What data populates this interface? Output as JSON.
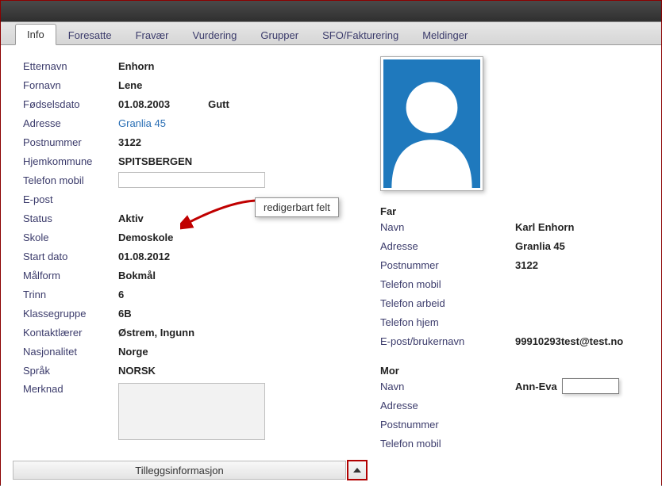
{
  "tabs": [
    "Info",
    "Foresatte",
    "Fravær",
    "Vurdering",
    "Grupper",
    "SFO/Fakturering",
    "Meldinger"
  ],
  "active_tab": 0,
  "callout": "redigerbart felt",
  "student": {
    "labels": {
      "etternavn": "Etternavn",
      "fornavn": "Fornavn",
      "fodselsdato": "Fødselsdato",
      "adresse": "Adresse",
      "postnummer": "Postnummer",
      "hjemkommune": "Hjemkommune",
      "telefon_mobil": "Telefon mobil",
      "epost": "E-post",
      "status": "Status",
      "skole": "Skole",
      "start_dato": "Start dato",
      "maalform": "Målform",
      "trinn": "Trinn",
      "klassegruppe": "Klassegruppe",
      "kontaktlaerer": "Kontaktlærer",
      "nasjonalitet": "Nasjonalitet",
      "spraak": "Språk",
      "merknad": "Merknad"
    },
    "values": {
      "etternavn": "Enhorn",
      "fornavn": "Lene",
      "fodselsdato": "01.08.2003",
      "gender": "Gutt",
      "adresse": "Granlia 45",
      "postnummer": "3122",
      "hjemkommune": "SPITSBERGEN",
      "telefon_mobil": "",
      "epost": "",
      "status": "Aktiv",
      "skole": "Demoskole",
      "start_dato": "01.08.2012",
      "maalform": "Bokmål",
      "trinn": "6",
      "klassegruppe": "6B",
      "kontaktlaerer": "Østrem, Ingunn",
      "nasjonalitet": "Norge",
      "spraak": "NORSK",
      "merknad": ""
    }
  },
  "far": {
    "heading": "Far",
    "labels": {
      "navn": "Navn",
      "adresse": "Adresse",
      "postnummer": "Postnummer",
      "telefon_mobil": "Telefon mobil",
      "telefon_arbeid": "Telefon arbeid",
      "telefon_hjem": "Telefon hjem",
      "epost": "E-post/brukernavn"
    },
    "values": {
      "navn": "Karl Enhorn",
      "adresse": "Granlia 45",
      "postnummer": "3122",
      "telefon_mobil": "",
      "telefon_arbeid": "",
      "telefon_hjem": "",
      "epost": "99910293test@test.no"
    }
  },
  "mor": {
    "heading": "Mor",
    "labels": {
      "navn": "Navn",
      "adresse": "Adresse",
      "postnummer": "Postnummer",
      "telefon_mobil": "Telefon mobil"
    },
    "values": {
      "navn": "Ann-Eva",
      "navn_extra": "",
      "adresse": "",
      "postnummer": "",
      "telefon_mobil": ""
    }
  },
  "expander": {
    "label": "Tilleggsinformasjon"
  }
}
